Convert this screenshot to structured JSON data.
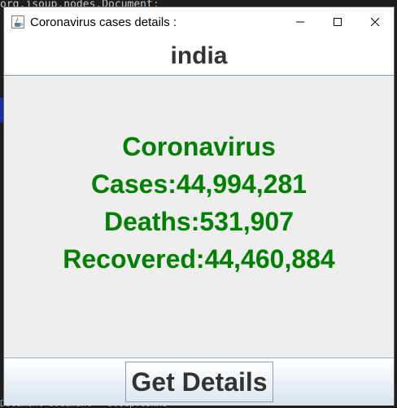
{
  "background": {
    "code_line": "org.jsoup.nodes.Document",
    "code_semicolon": ";",
    "bottom_line": "Document document = Jsoup.conne"
  },
  "window": {
    "title": "Coronavirus cases details :",
    "icon": "java-cup-icon",
    "controls": [
      "minimize-icon",
      "maximize-icon",
      "close-icon"
    ]
  },
  "country_field": {
    "value": "india"
  },
  "stats": {
    "heading": "Coronavirus",
    "cases": "Cases:44,994,281",
    "deaths": "Deaths:531,907",
    "recovered": "Recovered:44,460,884"
  },
  "footer": {
    "button_label": "Get Details"
  },
  "colors": {
    "stats_text": "#008000",
    "window_bg": "#eeeeee",
    "title_bg": "#ffffff"
  }
}
